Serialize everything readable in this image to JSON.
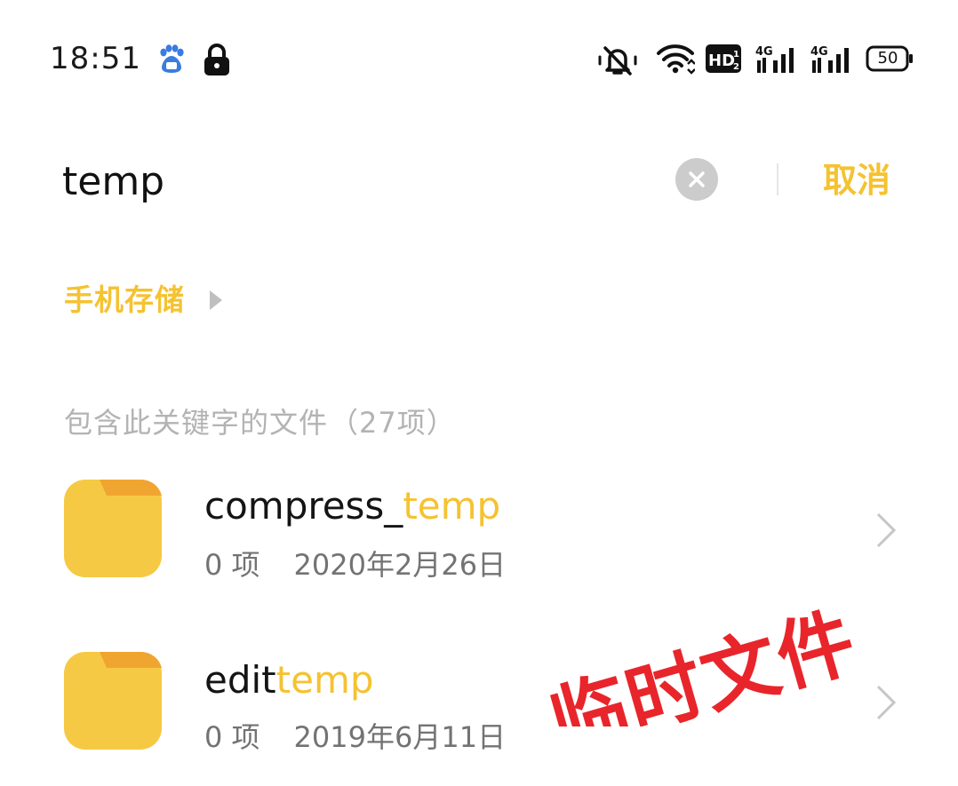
{
  "status_bar": {
    "time": "18:51",
    "battery": "50",
    "icons": [
      "baidu-icon",
      "lock-icon",
      "mute-icon",
      "wifi-icon",
      "hd-icon",
      "signal-4g-icon",
      "signal-4g-icon",
      "battery-icon"
    ]
  },
  "search": {
    "value": "temp",
    "cancel_label": "取消"
  },
  "breadcrumb": {
    "label": "手机存储"
  },
  "results": {
    "header_label": "包含此关键字的文件",
    "header_count": "（27项）",
    "items": [
      {
        "name_prefix": "compress_",
        "name_match": "temp",
        "count": "0 项",
        "date": "2020年2月26日"
      },
      {
        "name_prefix": "edit",
        "name_match": "temp",
        "count": "0 项",
        "date": "2019年6月11日"
      }
    ]
  },
  "watermark": {
    "text": "临时文件"
  },
  "colors": {
    "accent": "#f5c230",
    "folder": "#f6c944",
    "folder_tab": "#f0a530",
    "stamp": "#e8252b",
    "meta_text": "#737373",
    "header_text": "#b3b3b3"
  }
}
